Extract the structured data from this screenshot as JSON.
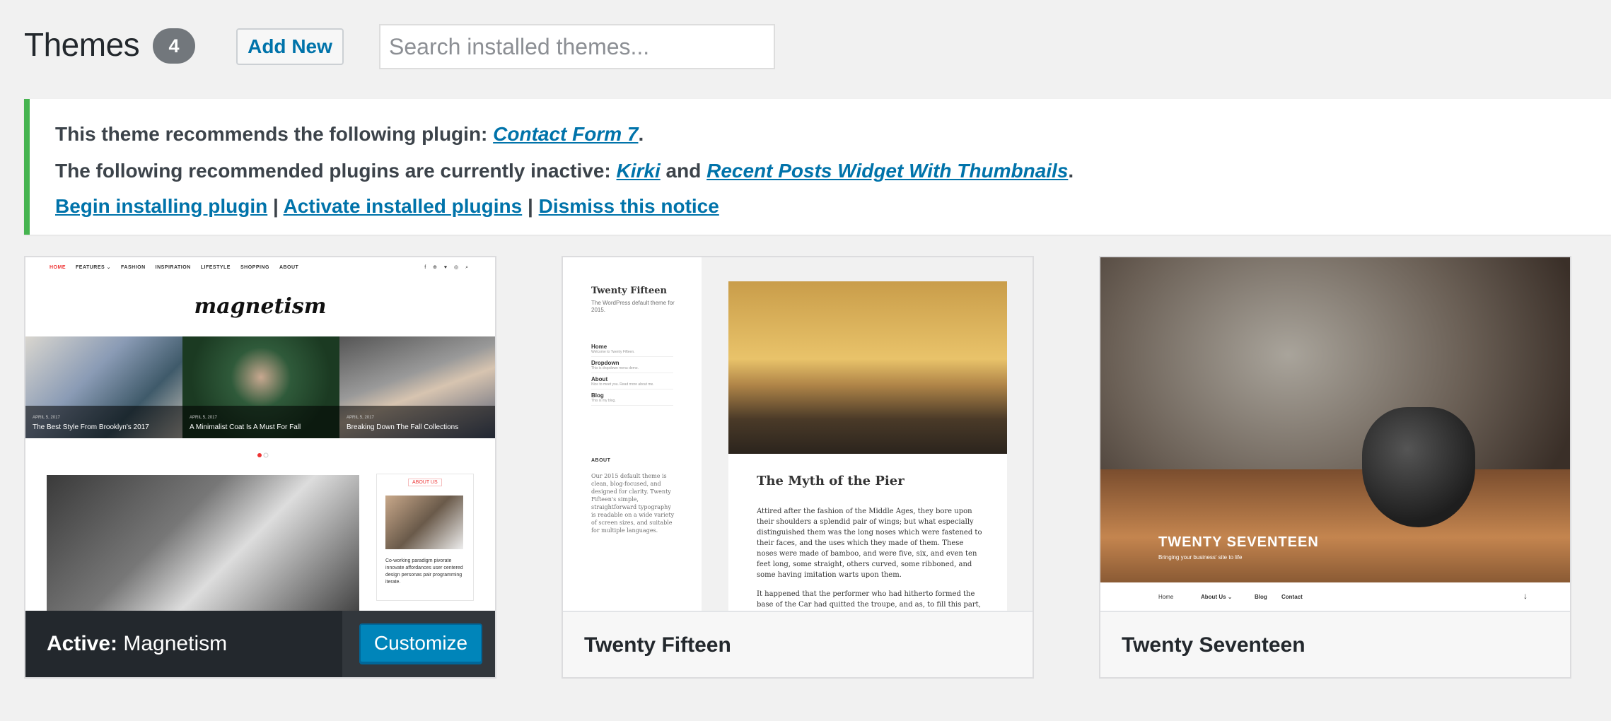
{
  "header": {
    "title": "Themes",
    "count": "4",
    "add_new": "Add New",
    "search_placeholder": "Search installed themes..."
  },
  "notice": {
    "line1_prefix": "This theme recommends the following plugin: ",
    "line1_link": "Contact Form 7",
    "line1_suffix": ".",
    "line2_prefix": "The following recommended plugins are currently inactive: ",
    "line2_link1": "Kirki",
    "line2_and": " and ",
    "line2_link2": "Recent Posts Widget With Thumbnails",
    "line2_suffix": ".",
    "link_begin": "Begin installing plugin",
    "link_activate": "Activate installed plugins",
    "link_dismiss": "Dismiss this notice",
    "separator": " | "
  },
  "themes": [
    {
      "active_label": "Active:",
      "name": " Magnetism",
      "customize": "Customize",
      "preview": {
        "nav": [
          "HOME",
          "FEATURES ⌄",
          "FASHION",
          "INSPIRATION",
          "LIFESTYLE",
          "SHOPPING",
          "ABOUT"
        ],
        "social": "f ⊕ ♥ ◎  ⌕",
        "logo": "magnetism",
        "slides": [
          {
            "date": "APRIL 5, 2017",
            "title": "The Best Style From Brooklyn's 2017"
          },
          {
            "date": "APRIL 5, 2017",
            "title": "A Minimalist Coat Is A Must For Fall"
          },
          {
            "date": "APRIL 5, 2017",
            "title": "Breaking Down The Fall Collections"
          }
        ],
        "widget_title": "ABOUT US",
        "widget_text": "Co-working paradigm pivorate innovate affordances user centered design personas pair programming iterate."
      }
    },
    {
      "name": "Twenty Fifteen",
      "preview": {
        "site_title": "Twenty Fifteen",
        "site_desc": "The WordPress default theme for 2015.",
        "menu": [
          {
            "label": "Home",
            "sub": "Welcome to Twenty Fifteen."
          },
          {
            "label": "Dropdown",
            "sub": "This is dropdown menu demo."
          },
          {
            "label": "About",
            "sub": "Nice to meet you. Read more about me."
          },
          {
            "label": "Blog",
            "sub": "This is my blog."
          }
        ],
        "about_heading": "ABOUT",
        "about_text": "Our 2015 default theme is clean, blog-focused, and designed for clarity. Twenty Fifteen's simple, straightforward typography is readable on a wide variety of screen sizes, and suitable for multiple languages.",
        "post_title": "The Myth of the Pier",
        "post_p1": "Attired after the fashion of the Middle Ages, they bore upon their shoulders a splendid pair of wings; but what especially distinguished them was the long noses which were fastened to their faces, and the uses which they made of them. These noses were made of bamboo, and were five, six, and even ten feet long, some straight, others curved, some ribboned, and some having imitation warts upon them.",
        "post_p2": "It happened that the performer who had hitherto formed the base of the Car had quitted the troupe, and as, to fill this part, only strength and adroitness were necessary."
      }
    },
    {
      "name": "Twenty Seventeen",
      "preview": {
        "site_title": "TWENTY SEVENTEEN",
        "tagline": "Bringing your business' site to life",
        "nav": [
          "Home",
          "About Us ⌄",
          "Blog",
          "Contact"
        ],
        "scroll": "↓"
      }
    }
  ]
}
